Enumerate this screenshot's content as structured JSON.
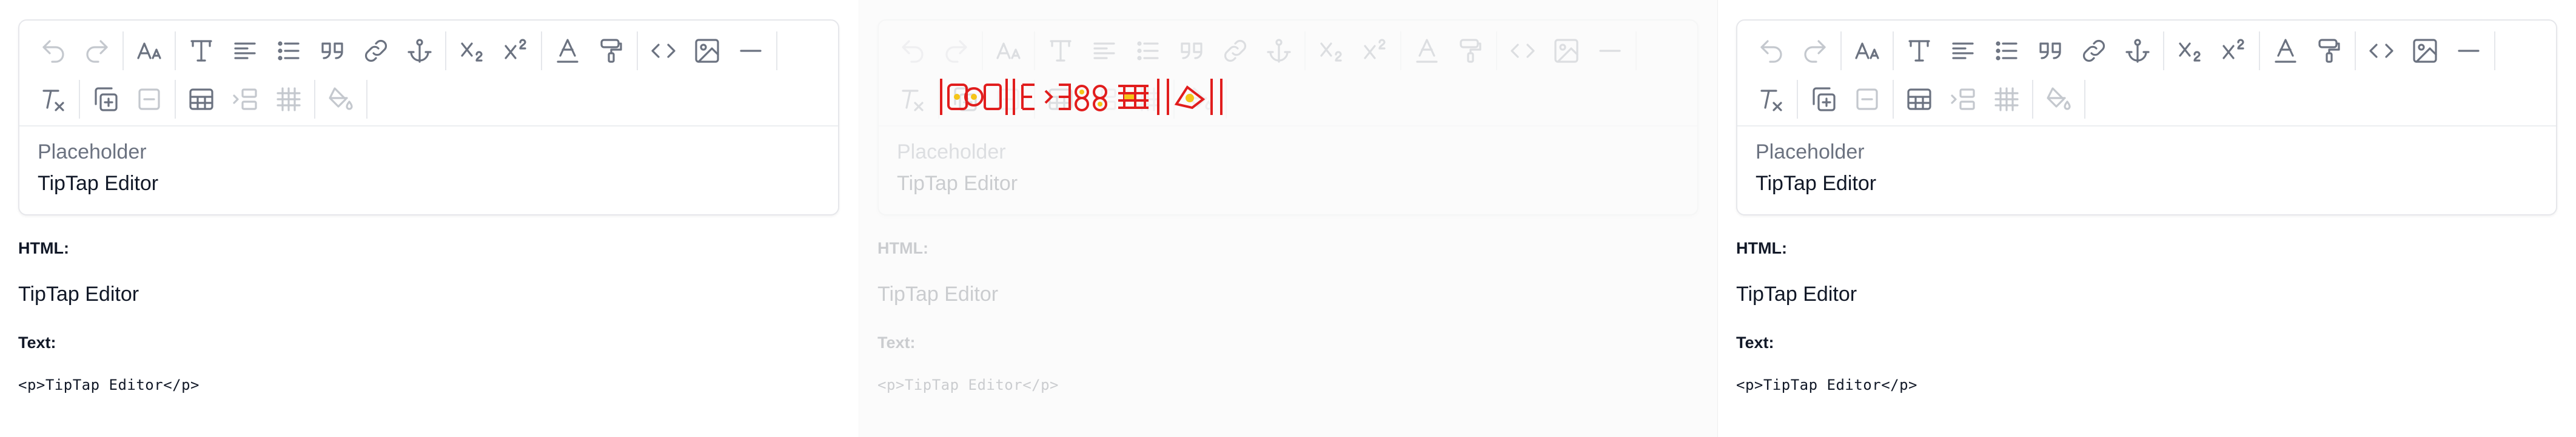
{
  "panels": [
    {
      "editor": {
        "placeholder": "Placeholder",
        "content": "TipTap Editor"
      },
      "output": {
        "html_label": "HTML:",
        "html_value": "TipTap Editor",
        "text_label": "Text:",
        "text_value": "<p>TipTap Editor</p>"
      }
    },
    {
      "editor": {
        "placeholder": "Placeholder",
        "content": "TipTap Editor"
      },
      "output": {
        "html_label": "HTML:",
        "html_value": "TipTap Editor",
        "text_label": "Text:",
        "text_value": "<p>TipTap Editor</p>"
      }
    },
    {
      "editor": {
        "placeholder": "Placeholder",
        "content": "TipTap Editor"
      },
      "output": {
        "html_label": "HTML:",
        "html_value": "TipTap Editor",
        "text_label": "Text:",
        "text_value": "<p>TipTap Editor</p>"
      }
    }
  ],
  "toolbar_icons": {
    "row1": [
      "undo-icon",
      "redo-icon",
      "font-size-icon",
      "heading-icon",
      "align-left-icon",
      "bullet-list-icon",
      "blockquote-icon",
      "link-icon",
      "anchor-icon",
      "subscript-icon",
      "superscript-icon",
      "text-color-icon",
      "format-painter-icon",
      "code-icon",
      "image-icon",
      "horizontal-rule-icon"
    ],
    "row2": [
      "clear-format-icon",
      "duplicate-icon",
      "remove-icon",
      "table-icon",
      "insert-row-icon",
      "table-grid-icon",
      "fill-color-icon"
    ]
  },
  "colors": {
    "garble_red": "#e11d1d",
    "garble_yellow": "#f5c518"
  }
}
